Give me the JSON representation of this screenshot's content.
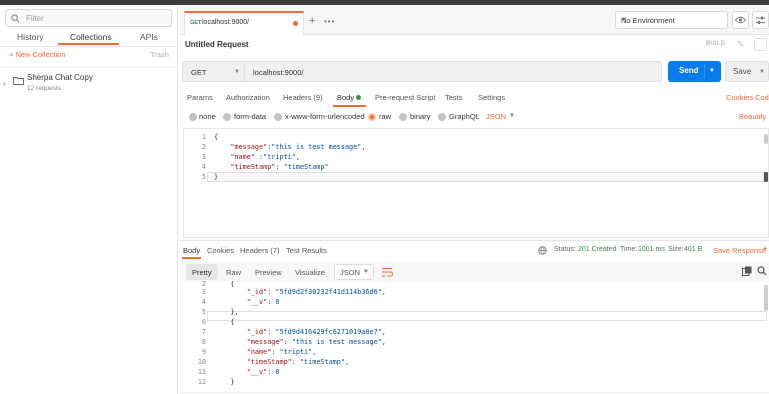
{
  "sidebar": {
    "filter_placeholder": "Filter",
    "tabs": [
      "History",
      "Collections",
      "APIs"
    ],
    "new_collection": "+ New Collection",
    "trash": "Trash",
    "collection": {
      "name": "Sherpa Chat Copy",
      "count": "12 requests"
    }
  },
  "tabbar": {
    "tab_method": "GET",
    "tab_title": "localhost:9000/",
    "environment": "No Environment"
  },
  "request": {
    "title": "Untitled Request",
    "build": "BUILD",
    "method": "GET",
    "url": "localhost:9000/",
    "send": "Send",
    "save": "Save",
    "tabs": {
      "params": "Params",
      "authorization": "Authorization",
      "headers": "Headers (9)",
      "body": "Body",
      "prerequest": "Pre-request Script",
      "tests": "Tests",
      "settings": "Settings",
      "cookies": "Cookies",
      "code": "Code"
    },
    "body_types": [
      "none",
      "form-data",
      "x-www-form-urlencoded",
      "raw",
      "binary",
      "GraphQL"
    ],
    "selected_body_type": "raw",
    "format": "JSON",
    "beautify": "Beautify",
    "code_lines": [
      "1",
      "2",
      "3",
      "4",
      "5"
    ],
    "code": {
      "l1": "{",
      "l2_key": "\"message\"",
      "l2_val": ":\"this is test message\",",
      "l3_key": "\"name\"",
      "l3_val": " :\"tripti\",",
      "l4_key": "\"timeStamp\"",
      "l4_val": ": \"timeStamp\"",
      "l5": "}"
    }
  },
  "response": {
    "tabs": {
      "body": "Body",
      "cookies": "Cookies",
      "headers": "Headers (7)",
      "tests": "Test Results"
    },
    "status_label": "Status:",
    "status": "201 Created",
    "time_label": "Time:",
    "time": "1001 ms",
    "size_label": "Size:",
    "size": "401 B",
    "save_response": "Save Response",
    "views": [
      "Pretty",
      "Raw",
      "Preview",
      "Visualize"
    ],
    "format": "JSON",
    "line_numbers": [
      "2",
      "3",
      "4",
      "5",
      "6",
      "7",
      "8",
      "9",
      "10",
      "11",
      "12"
    ],
    "code": {
      "l2": "{",
      "l3_key": "\"_id\"",
      "l3_val": ": \"5fd9d2f30232f41d114b36d6\",",
      "l4_key": "\"__v\"",
      "l4_val": ": 0",
      "l5": "},",
      "l6": "{",
      "l7_key": "\"_id\"",
      "l7_val": ": \"5fd9d416429fc6271019a8e7\",",
      "l8_key": "\"message\"",
      "l8_val": ": \"this is test message\",",
      "l9_key": "\"name\"",
      "l9_val": ": \"tripti\",",
      "l10_key": "\"timeStamp\"",
      "l10_val": ": \"timeStamp\",",
      "l11_key": "\"__v\"",
      "l11_val": ": 0",
      "l12": "}"
    }
  },
  "colors": {
    "accent": "#f26b3a",
    "send": "#097bed",
    "success": "#3c8b49",
    "key": "#a31515",
    "string": "#0451a5"
  }
}
